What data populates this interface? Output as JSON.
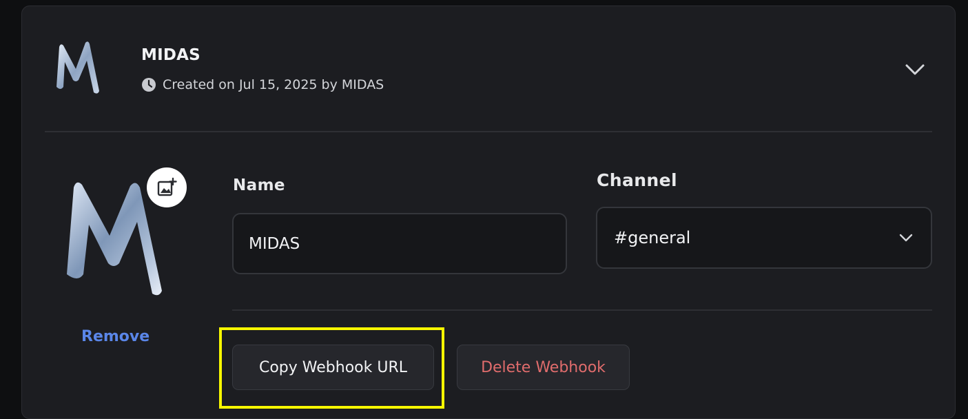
{
  "webhook": {
    "title": "MIDAS",
    "created_text": "Created on Jul 15, 2025 by MIDAS"
  },
  "editor": {
    "remove_label": "Remove",
    "name_label": "Name",
    "name_value": "MIDAS",
    "channel_label": "Channel",
    "channel_value": "#general"
  },
  "actions": {
    "copy_label": "Copy Webhook URL",
    "delete_label": "Delete Webhook"
  },
  "icons": {
    "clock": "clock-icon",
    "chevron": "chevron-down-icon",
    "upload": "image-add-icon"
  },
  "colors": {
    "remove_link": "#5a86e8",
    "delete_text": "#e06c6c",
    "highlight": "#f7f700"
  }
}
